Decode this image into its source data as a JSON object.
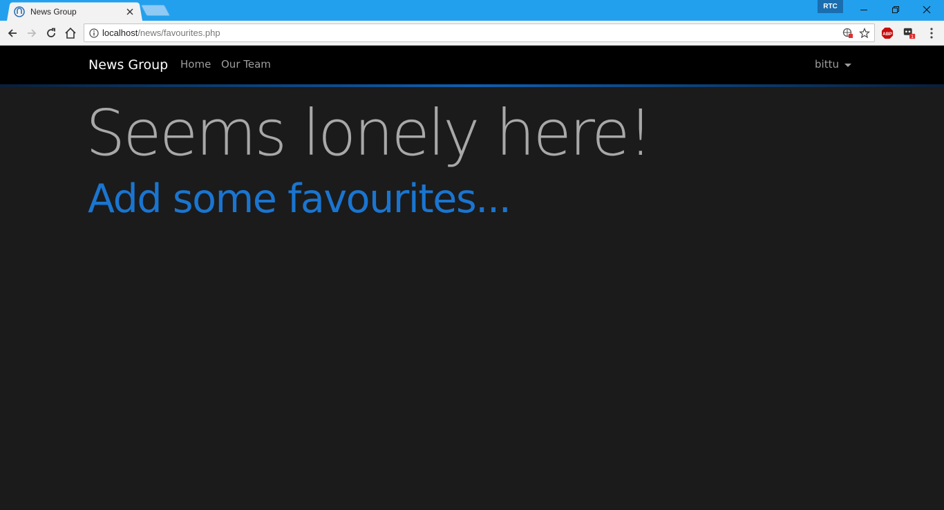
{
  "browser": {
    "tab": {
      "title": "News Group"
    },
    "rtc_badge": "RTC",
    "address_bar": {
      "host": "localhost",
      "path": "/news/favourites.php"
    },
    "extensions": {
      "abp_label": "ABP",
      "notification_count": "1"
    },
    "colors": {
      "titlebar": "#22a0ee",
      "tab": "#f2f2f2"
    }
  },
  "site": {
    "brand": "News Group",
    "nav": [
      {
        "label": "Home"
      },
      {
        "label": "Our Team"
      }
    ],
    "user": {
      "name": "bittu"
    },
    "colors": {
      "navbar": "#000000",
      "accent": "#1a75d0",
      "background": "#1b1b1b"
    }
  },
  "content": {
    "title": "Seems lonely here!",
    "subtitle": "Add some favourites..."
  }
}
